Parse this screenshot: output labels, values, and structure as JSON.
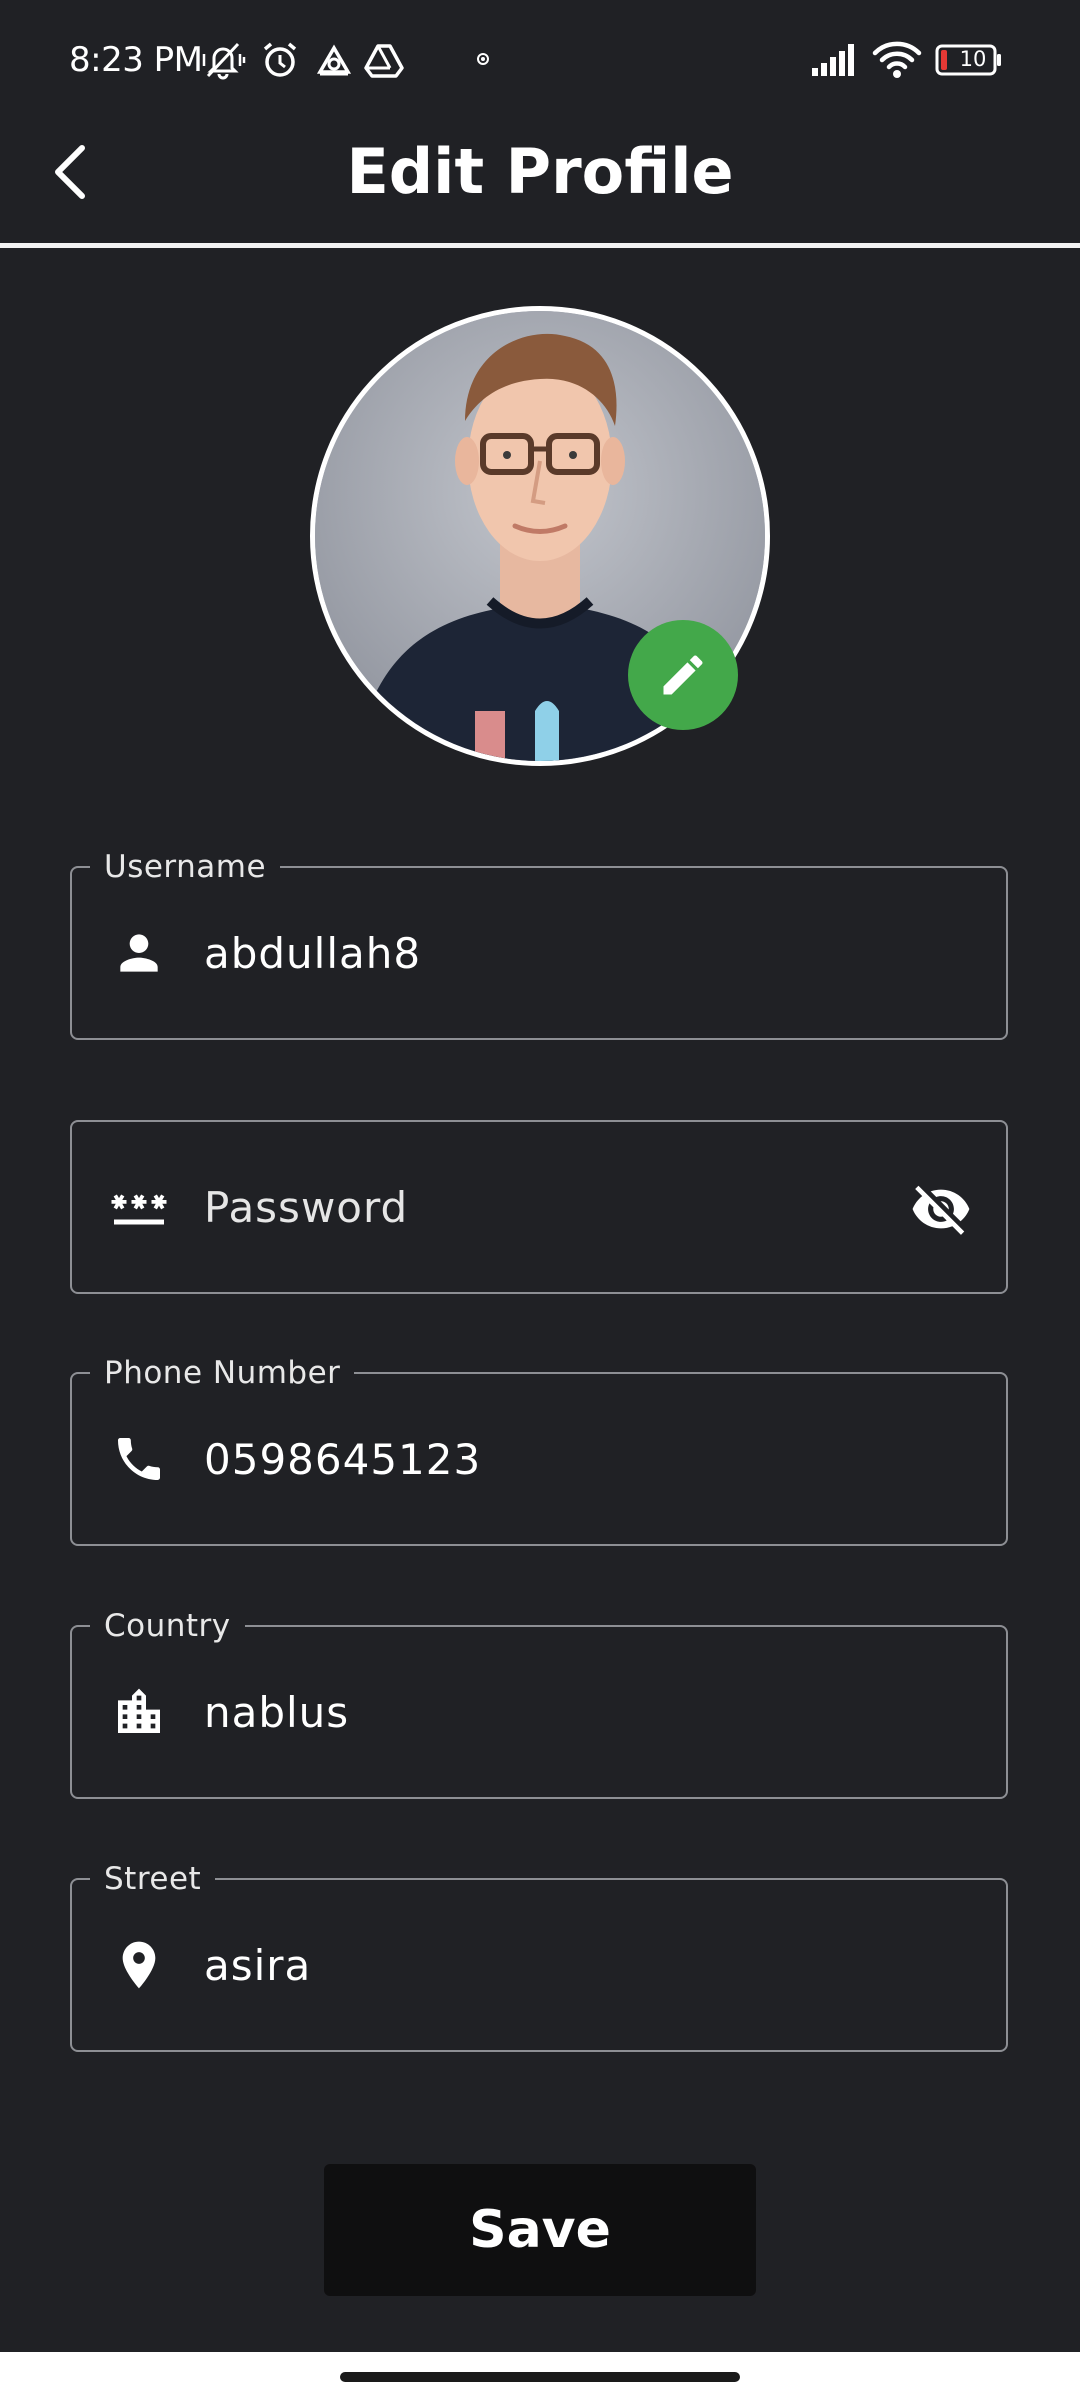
{
  "status_bar": {
    "time": "8:23 PM",
    "battery_level": "10",
    "icons": [
      "muted-notification-icon",
      "alarm-icon",
      "app-notification-icon",
      "drive-icon",
      "dot-icon",
      "signal-icon",
      "wifi-icon",
      "battery-icon"
    ]
  },
  "header": {
    "title": "Edit Profile",
    "back_icon": "chevron-left-icon"
  },
  "profile": {
    "edit_icon": "pencil-icon",
    "accent_color": "#43a84a"
  },
  "form": {
    "username": {
      "label": "Username",
      "value": "abdullah8",
      "icon": "person-icon"
    },
    "password": {
      "placeholder": "Password",
      "value": "",
      "icon": "password-icon",
      "toggle_icon": "eye-off-icon"
    },
    "phone": {
      "label": "Phone Number",
      "value": "0598645123",
      "icon": "phone-icon"
    },
    "country": {
      "label": "Country",
      "value": "nablus",
      "icon": "city-icon"
    },
    "street": {
      "label": "Street",
      "value": "asira",
      "icon": "location-pin-icon"
    }
  },
  "actions": {
    "save_label": "Save"
  }
}
